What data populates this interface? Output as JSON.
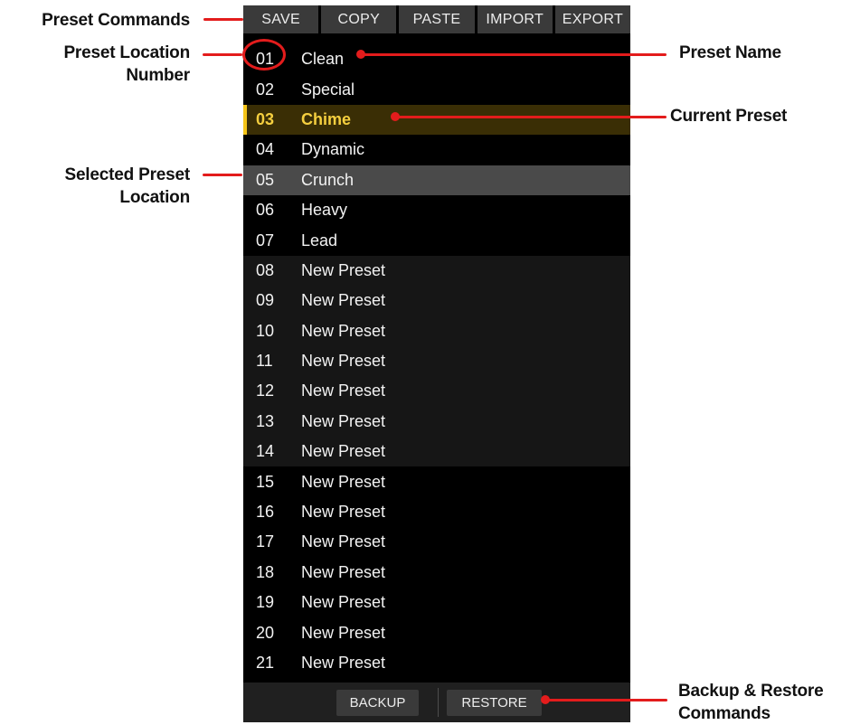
{
  "colors": {
    "callout_red": "#e31c1c",
    "panel_bg": "#000000",
    "current_text": "#f5cf3f",
    "current_bar": "#f5c518",
    "selected_bg": "#4a4a4a"
  },
  "callouts": {
    "preset_commands": "Preset Commands",
    "preset_location_number_line1": "Preset Location",
    "preset_location_number_line2": "Number",
    "selected_preset_location_line1": "Selected Preset",
    "selected_preset_location_line2": "Location",
    "preset_name": "Preset Name",
    "current_preset": "Current Preset",
    "backup_restore_line1": "Backup & Restore",
    "backup_restore_line2": "Commands"
  },
  "toolbar": {
    "save": "SAVE",
    "copy": "COPY",
    "paste": "PASTE",
    "import": "IMPORT",
    "export": "EXPORT"
  },
  "presets": [
    {
      "num": "01",
      "name": "Clean",
      "state": "normal"
    },
    {
      "num": "02",
      "name": "Special",
      "state": "normal"
    },
    {
      "num": "03",
      "name": "Chime",
      "state": "current"
    },
    {
      "num": "04",
      "name": "Dynamic",
      "state": "normal"
    },
    {
      "num": "05",
      "name": "Crunch",
      "state": "selected"
    },
    {
      "num": "06",
      "name": "Heavy",
      "state": "normal"
    },
    {
      "num": "07",
      "name": "Lead",
      "state": "normal"
    },
    {
      "num": "08",
      "name": "New Preset",
      "state": "shade"
    },
    {
      "num": "09",
      "name": "New Preset",
      "state": "shade"
    },
    {
      "num": "10",
      "name": "New Preset",
      "state": "shade"
    },
    {
      "num": "11",
      "name": "New Preset",
      "state": "shade"
    },
    {
      "num": "12",
      "name": "New Preset",
      "state": "shade"
    },
    {
      "num": "13",
      "name": "New Preset",
      "state": "shade"
    },
    {
      "num": "14",
      "name": "New Preset",
      "state": "shade"
    },
    {
      "num": "15",
      "name": "New Preset",
      "state": "normal"
    },
    {
      "num": "16",
      "name": "New Preset",
      "state": "normal"
    },
    {
      "num": "17",
      "name": "New Preset",
      "state": "normal"
    },
    {
      "num": "18",
      "name": "New Preset",
      "state": "normal"
    },
    {
      "num": "19",
      "name": "New Preset",
      "state": "normal"
    },
    {
      "num": "20",
      "name": "New Preset",
      "state": "normal"
    },
    {
      "num": "21",
      "name": "New Preset",
      "state": "normal"
    }
  ],
  "footer": {
    "backup": "BACKUP",
    "restore": "RESTORE"
  }
}
